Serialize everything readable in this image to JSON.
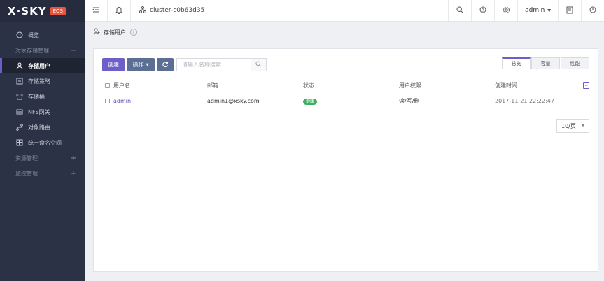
{
  "brand": {
    "logo": "X·SKY",
    "badge": "EOS"
  },
  "topbar": {
    "cluster_name": "cluster-c0b63d35",
    "user": "admin"
  },
  "sidebar": {
    "items": [
      {
        "label": "概览",
        "icon": "dashboard-icon"
      },
      {
        "group": "对象存储管理",
        "toggle": "−"
      },
      {
        "label": "存储用户",
        "icon": "user-icon",
        "active": true
      },
      {
        "label": "存储策略",
        "icon": "policy-icon"
      },
      {
        "label": "存储桶",
        "icon": "bucket-icon"
      },
      {
        "label": "NFS网关",
        "icon": "gateway-icon"
      },
      {
        "label": "对象路由",
        "icon": "route-icon"
      },
      {
        "label": "统一命名空间",
        "icon": "namespace-icon"
      },
      {
        "group": "资源管理",
        "toggle": "+"
      },
      {
        "group": "监控管理",
        "toggle": "+"
      }
    ]
  },
  "breadcrumb": {
    "title": "存储用户",
    "info": "i"
  },
  "toolbar": {
    "create": "创建",
    "operate": "操作",
    "search_placeholder": "请输入名称搜索"
  },
  "tabs": [
    {
      "label": "总览",
      "active": true
    },
    {
      "label": "容量"
    },
    {
      "label": "性能"
    }
  ],
  "table": {
    "headers": [
      "用户名",
      "邮箱",
      "状态",
      "用户权限",
      "创建时间"
    ],
    "rows": [
      {
        "username": "admin",
        "email": "admin1@xsky.com",
        "status": "健康",
        "permission": "读/写/删",
        "created": "2017-11-21 22:22:47"
      }
    ]
  },
  "pager": {
    "page_size": "10/页"
  },
  "colors": {
    "accent": "#6c5fc7",
    "sidebar": "#2b3245",
    "success": "#3bb15f",
    "brand_badge": "#e8543d"
  }
}
